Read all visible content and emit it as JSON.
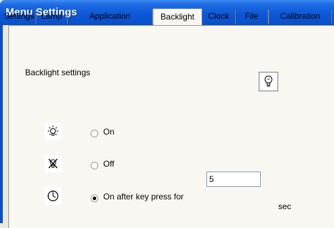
{
  "window": {
    "title": "Menu Settings"
  },
  "tabs": [
    {
      "label": "Settings"
    },
    {
      "label": "Lamp"
    },
    {
      "label": "Application"
    },
    {
      "label": "Backlight"
    },
    {
      "label": "Clock"
    },
    {
      "label": "File"
    },
    {
      "label": "Calibration"
    }
  ],
  "active_tab": "Backlight",
  "panel": {
    "heading": "Backlight settings",
    "header_icon": "light-bulb-icon",
    "options": [
      {
        "label": "On",
        "icon": "backlight-on-icon",
        "selected": false
      },
      {
        "label": "Off",
        "icon": "backlight-off-icon",
        "selected": false
      },
      {
        "label": "On after key press for",
        "icon": "timer-icon",
        "selected": true
      }
    ],
    "timeout": {
      "value": "5",
      "unit": "sec"
    }
  },
  "colors": {
    "title_bar": "#0a4fc9",
    "panel": "#f8f7f2",
    "background": "#ece9d8"
  }
}
